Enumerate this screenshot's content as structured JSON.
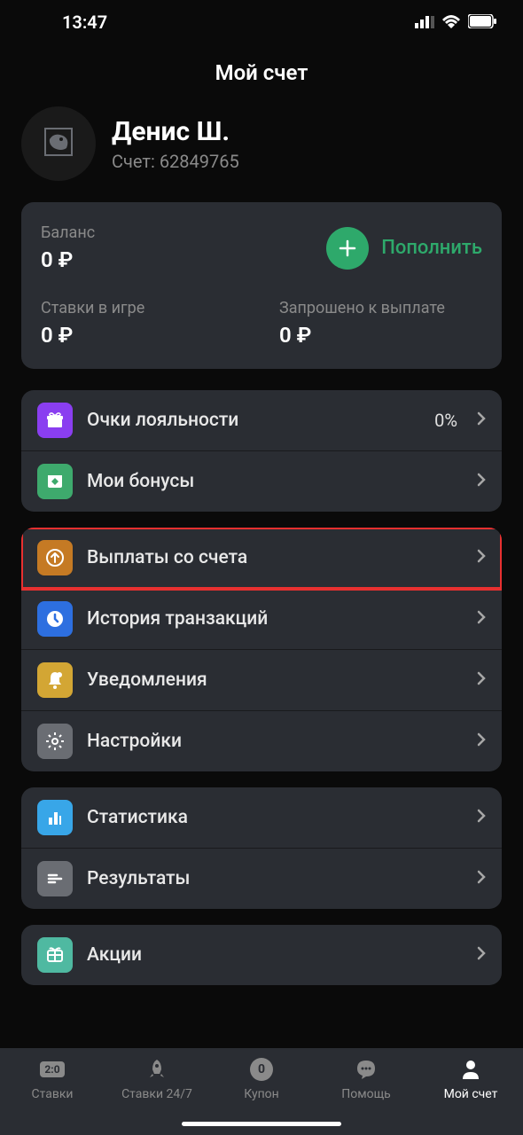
{
  "status": {
    "time": "13:47"
  },
  "page": {
    "title": "Мой счет"
  },
  "profile": {
    "name": "Денис Ш.",
    "account_label": "Счет: 62849765"
  },
  "balance": {
    "main_label": "Баланс",
    "main_amount": "0 ₽",
    "topup_label": "Пополнить",
    "in_play_label": "Ставки в игре",
    "in_play_amount": "0 ₽",
    "requested_label": "Запрошено к выплате",
    "requested_amount": "0 ₽"
  },
  "menu": {
    "loyalty": {
      "label": "Очки лояльности",
      "value": "0%"
    },
    "bonuses": {
      "label": "Мои бонусы"
    },
    "withdraw": {
      "label": "Выплаты со счета"
    },
    "history": {
      "label": "История транзакций"
    },
    "notifications": {
      "label": "Уведомления"
    },
    "settings": {
      "label": "Настройки"
    },
    "stats": {
      "label": "Статистика"
    },
    "results": {
      "label": "Результаты"
    },
    "promo": {
      "label": "Акции"
    }
  },
  "nav": {
    "bets": {
      "label": "Ставки",
      "score": "2:0"
    },
    "bets247": {
      "label": "Ставки 24/7"
    },
    "coupon": {
      "label": "Купон",
      "count": "0"
    },
    "help": {
      "label": "Помощь"
    },
    "account": {
      "label": "Мой счет"
    }
  },
  "colors": {
    "loyalty": "#8a3ef0",
    "bonuses": "#3eaa6d",
    "withdraw": "#c57a24",
    "history": "#2d6fe0",
    "notifications": "#d3a634",
    "settings": "#6a6d73",
    "stats": "#38a6e8",
    "results": "#6a6d73",
    "promo": "#4fb9a1"
  }
}
